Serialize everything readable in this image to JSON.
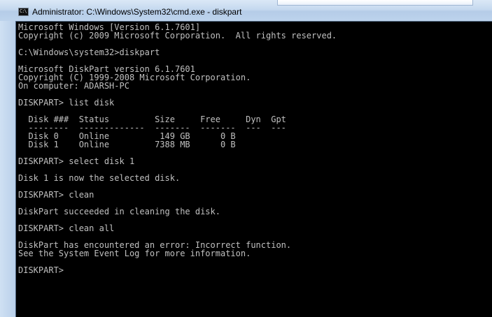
{
  "window": {
    "title": "Administrator: C:\\Windows\\System32\\cmd.exe - diskpart",
    "icon_text": "C:\\"
  },
  "console": {
    "lines": [
      "Microsoft Windows [Version 6.1.7601]",
      "Copyright (c) 2009 Microsoft Corporation.  All rights reserved.",
      "",
      "C:\\Windows\\system32>diskpart",
      "",
      "Microsoft DiskPart version 6.1.7601",
      "Copyright (C) 1999-2008 Microsoft Corporation.",
      "On computer: ADARSH-PC",
      "",
      "DISKPART> list disk",
      "",
      "  Disk ###  Status         Size     Free     Dyn  Gpt",
      "  --------  -------------  -------  -------  ---  ---",
      "  Disk 0    Online          149 GB      0 B",
      "  Disk 1    Online         7388 MB      0 B",
      "",
      "DISKPART> select disk 1",
      "",
      "Disk 1 is now the selected disk.",
      "",
      "DISKPART> clean",
      "",
      "DiskPart succeeded in cleaning the disk.",
      "",
      "DISKPART> clean all",
      "",
      "DiskPart has encountered an error: Incorrect function.",
      "See the System Event Log for more information.",
      "",
      "DISKPART> "
    ]
  },
  "colors": {
    "console_background": "#000000",
    "console_text": "#c0c0c0",
    "title_text": "#000000"
  }
}
